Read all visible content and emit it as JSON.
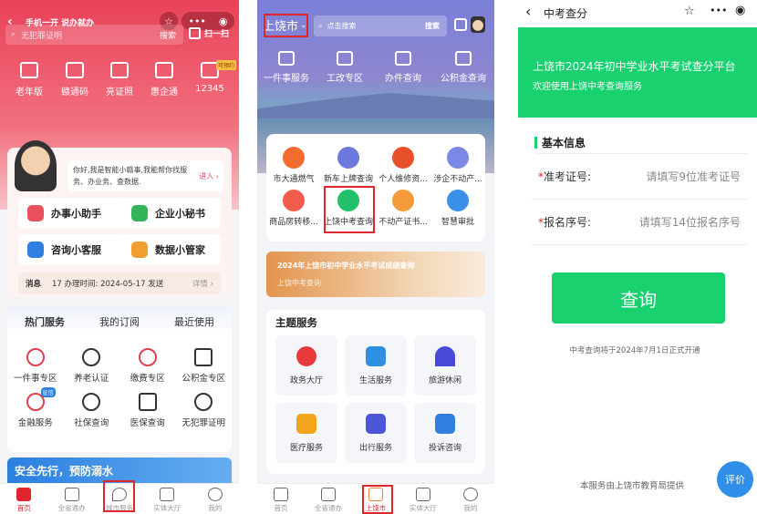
{
  "panel1": {
    "title": "手机一开 说办就办",
    "search_placeholder": "无犯罪证明",
    "search_button": "搜索",
    "scan_label": "扫一扫",
    "quick": [
      {
        "label": "老年版",
        "icon": "elder-icon"
      },
      {
        "label": "赣通码",
        "icon": "qr-code-icon"
      },
      {
        "label": "亮证照",
        "icon": "id-card-icon"
      },
      {
        "label": "惠企通",
        "icon": "building-icon"
      },
      {
        "label": "12345",
        "icon": "bank-icon",
        "badge": "可预约"
      }
    ],
    "assistant_text": "你好,我是智能小赣事,我能帮你找服务、办业务、查数据.",
    "assistant_enter": "进入 ›",
    "tools": [
      {
        "label": "办事小助手",
        "color": "#e8505b"
      },
      {
        "label": "企业小秘书",
        "color": "#34b45a"
      },
      {
        "label": "咨询小客服",
        "color": "#2f7fe0"
      },
      {
        "label": "数据小管家",
        "color": "#f0a030"
      }
    ],
    "message_label": "消息",
    "message_text": "17 办理时间: 2024-05-17 发送",
    "message_detail": "详情 ›",
    "tabs": [
      "热门服务",
      "我的订阅",
      "最近使用"
    ],
    "services": [
      {
        "label": "一件事专区"
      },
      {
        "label": "养老认证"
      },
      {
        "label": "缴费专区"
      },
      {
        "label": "公积金专区"
      },
      {
        "label": "金融服务",
        "badge": "征信"
      },
      {
        "label": "社保查询"
      },
      {
        "label": "医保查询"
      },
      {
        "label": "无犯罪证明"
      }
    ],
    "banner": "安全先行，预防溺水",
    "nav": [
      "首页",
      "全省通办",
      "城市服务",
      "实体大厅",
      "我的"
    ]
  },
  "panel2": {
    "city": "上饶市",
    "search_placeholder": "点击搜索",
    "search_button": "搜索",
    "quick": [
      "一件事服务",
      "工改专区",
      "办件查询",
      "公积金查询"
    ],
    "grid": [
      {
        "label": "市大通燃气",
        "color": "#f26b2f"
      },
      {
        "label": "新车上牌查询",
        "color": "#6c7ae0"
      },
      {
        "label": "个人维修资...",
        "color": "#e8502a"
      },
      {
        "label": "涉企不动产...",
        "color": "#7a88e6"
      },
      {
        "label": "商品房转移...",
        "color": "#ef5c4c"
      },
      {
        "label": "上饶中考查询",
        "color": "#22c06a"
      },
      {
        "label": "不动产证书...",
        "color": "#f59a3a"
      },
      {
        "label": "智慧审批",
        "color": "#3a8fe8"
      }
    ],
    "banner_title": "2024年上饶市初中学业水平考试成绩查询",
    "banner_sub": "上饶中考查询",
    "theme_title": "主题服务",
    "themes": [
      {
        "label": "政务大厅",
        "color": "#e83a3a"
      },
      {
        "label": "生活服务",
        "color": "#2f8fe0"
      },
      {
        "label": "旅游休闲",
        "color": "#4a4ad8"
      },
      {
        "label": "医疗服务",
        "color": "#f2a51c"
      },
      {
        "label": "出行服务",
        "color": "#4a55d8"
      },
      {
        "label": "投诉咨询",
        "color": "#2f7fe0"
      }
    ],
    "nav": [
      "首页",
      "全省通办",
      "上饶市",
      "实体大厅",
      "我的"
    ]
  },
  "panel3": {
    "title": "中考查分",
    "header_title": "上饶市2024年初中学业水平考试查分平台",
    "header_sub": "欢迎使用上饶中考查询服务",
    "section": "基本信息",
    "fields": [
      {
        "label": "准考证号:",
        "placeholder": "请填写9位准考证号"
      },
      {
        "label": "报名序号:",
        "placeholder": "请填写14位报名序号"
      }
    ],
    "query_button": "查询",
    "notice": "中考查询将于2024年7月1日正式开通",
    "footer": "本服务由上饶市教育局提供",
    "rate_button": "评价",
    "accent": "#19d16f"
  }
}
